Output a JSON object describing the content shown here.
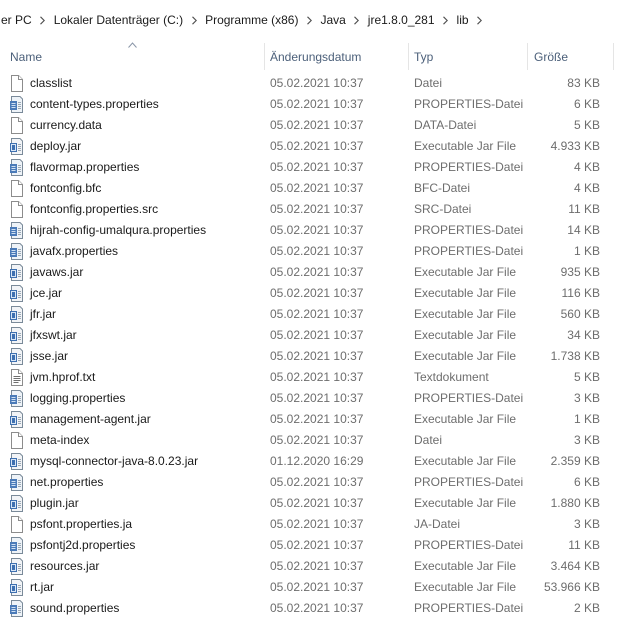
{
  "breadcrumb": [
    {
      "label": "er PC"
    },
    {
      "label": "Lokaler Datenträger (C:)"
    },
    {
      "label": "Programme (x86)"
    },
    {
      "label": "Java"
    },
    {
      "label": "jre1.8.0_281"
    },
    {
      "label": "lib"
    }
  ],
  "columns": {
    "name": "Name",
    "modified": "Änderungsdatum",
    "type": "Typ",
    "size": "Größe"
  },
  "sort": {
    "column": "name",
    "direction": "ascending"
  },
  "files": [
    {
      "name": "classlist",
      "modified": "05.02.2021 10:37",
      "type": "Datei",
      "size": "83 KB",
      "icon": "generic-file-icon"
    },
    {
      "name": "content-types.properties",
      "modified": "05.02.2021 10:37",
      "type": "PROPERTIES-Datei",
      "size": "6 KB",
      "icon": "properties-file-icon"
    },
    {
      "name": "currency.data",
      "modified": "05.02.2021 10:37",
      "type": "DATA-Datei",
      "size": "5 KB",
      "icon": "generic-file-icon"
    },
    {
      "name": "deploy.jar",
      "modified": "05.02.2021 10:37",
      "type": "Executable Jar File",
      "size": "4.933 KB",
      "icon": "jar-file-icon"
    },
    {
      "name": "flavormap.properties",
      "modified": "05.02.2021 10:37",
      "type": "PROPERTIES-Datei",
      "size": "4 KB",
      "icon": "properties-file-icon"
    },
    {
      "name": "fontconfig.bfc",
      "modified": "05.02.2021 10:37",
      "type": "BFC-Datei",
      "size": "4 KB",
      "icon": "generic-file-icon"
    },
    {
      "name": "fontconfig.properties.src",
      "modified": "05.02.2021 10:37",
      "type": "SRC-Datei",
      "size": "11 KB",
      "icon": "generic-file-icon"
    },
    {
      "name": "hijrah-config-umalqura.properties",
      "modified": "05.02.2021 10:37",
      "type": "PROPERTIES-Datei",
      "size": "14 KB",
      "icon": "properties-file-icon"
    },
    {
      "name": "javafx.properties",
      "modified": "05.02.2021 10:37",
      "type": "PROPERTIES-Datei",
      "size": "1 KB",
      "icon": "properties-file-icon"
    },
    {
      "name": "javaws.jar",
      "modified": "05.02.2021 10:37",
      "type": "Executable Jar File",
      "size": "935 KB",
      "icon": "jar-file-icon"
    },
    {
      "name": "jce.jar",
      "modified": "05.02.2021 10:37",
      "type": "Executable Jar File",
      "size": "116 KB",
      "icon": "jar-file-icon"
    },
    {
      "name": "jfr.jar",
      "modified": "05.02.2021 10:37",
      "type": "Executable Jar File",
      "size": "560 KB",
      "icon": "jar-file-icon"
    },
    {
      "name": "jfxswt.jar",
      "modified": "05.02.2021 10:37",
      "type": "Executable Jar File",
      "size": "34 KB",
      "icon": "jar-file-icon"
    },
    {
      "name": "jsse.jar",
      "modified": "05.02.2021 10:37",
      "type": "Executable Jar File",
      "size": "1.738 KB",
      "icon": "jar-file-icon"
    },
    {
      "name": "jvm.hprof.txt",
      "modified": "05.02.2021 10:37",
      "type": "Textdokument",
      "size": "5 KB",
      "icon": "text-file-icon"
    },
    {
      "name": "logging.properties",
      "modified": "05.02.2021 10:37",
      "type": "PROPERTIES-Datei",
      "size": "3 KB",
      "icon": "properties-file-icon"
    },
    {
      "name": "management-agent.jar",
      "modified": "05.02.2021 10:37",
      "type": "Executable Jar File",
      "size": "1 KB",
      "icon": "jar-file-icon"
    },
    {
      "name": "meta-index",
      "modified": "05.02.2021 10:37",
      "type": "Datei",
      "size": "3 KB",
      "icon": "generic-file-icon"
    },
    {
      "name": "mysql-connector-java-8.0.23.jar",
      "modified": "01.12.2020 16:29",
      "type": "Executable Jar File",
      "size": "2.359 KB",
      "icon": "jar-file-icon"
    },
    {
      "name": "net.properties",
      "modified": "05.02.2021 10:37",
      "type": "PROPERTIES-Datei",
      "size": "6 KB",
      "icon": "properties-file-icon"
    },
    {
      "name": "plugin.jar",
      "modified": "05.02.2021 10:37",
      "type": "Executable Jar File",
      "size": "1.880 KB",
      "icon": "jar-file-icon"
    },
    {
      "name": "psfont.properties.ja",
      "modified": "05.02.2021 10:37",
      "type": "JA-Datei",
      "size": "3 KB",
      "icon": "generic-file-icon"
    },
    {
      "name": "psfontj2d.properties",
      "modified": "05.02.2021 10:37",
      "type": "PROPERTIES-Datei",
      "size": "11 KB",
      "icon": "properties-file-icon"
    },
    {
      "name": "resources.jar",
      "modified": "05.02.2021 10:37",
      "type": "Executable Jar File",
      "size": "3.464 KB",
      "icon": "jar-file-icon"
    },
    {
      "name": "rt.jar",
      "modified": "05.02.2021 10:37",
      "type": "Executable Jar File",
      "size": "53.966 KB",
      "icon": "jar-file-icon"
    },
    {
      "name": "sound.properties",
      "modified": "05.02.2021 10:37",
      "type": "PROPERTIES-Datei",
      "size": "2 KB",
      "icon": "properties-file-icon"
    }
  ]
}
